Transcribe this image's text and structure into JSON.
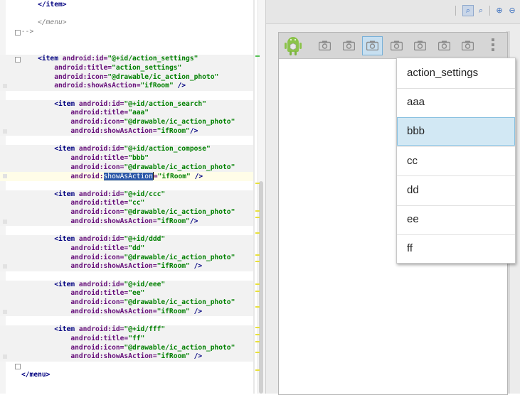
{
  "editor": {
    "lines": [
      [
        {
          "t": "    </item>",
          "c": "tag"
        }
      ],
      [],
      [
        {
          "t": "    </menu>",
          "c": "comment"
        }
      ],
      [
        {
          "t": "-->",
          "c": "comment"
        }
      ],
      [],
      [],
      [
        {
          "t": "    <item ",
          "c": "tag"
        },
        {
          "t": "android:id=",
          "c": "attr"
        },
        {
          "t": "\"@+id/action_settings\"",
          "c": "val"
        }
      ],
      [
        {
          "t": "        ",
          "c": "plain"
        },
        {
          "t": "android:title=",
          "c": "attr"
        },
        {
          "t": "\"action_settings\"",
          "c": "val"
        }
      ],
      [
        {
          "t": "        ",
          "c": "plain"
        },
        {
          "t": "android:icon=",
          "c": "attr"
        },
        {
          "t": "\"@drawable/ic_action_photo\"",
          "c": "val"
        }
      ],
      [
        {
          "t": "        ",
          "c": "plain"
        },
        {
          "t": "android:showAsAction=",
          "c": "attr"
        },
        {
          "t": "\"ifRoom\"",
          "c": "val"
        },
        {
          "t": " />",
          "c": "tag"
        }
      ],
      [],
      [
        {
          "t": "        <item ",
          "c": "tag"
        },
        {
          "t": "android:id=",
          "c": "attr"
        },
        {
          "t": "\"@+id/action_search\"",
          "c": "val"
        }
      ],
      [
        {
          "t": "            ",
          "c": "plain"
        },
        {
          "t": "android:title=",
          "c": "attr"
        },
        {
          "t": "\"aaa\"",
          "c": "val"
        }
      ],
      [
        {
          "t": "            ",
          "c": "plain"
        },
        {
          "t": "android:icon=",
          "c": "attr"
        },
        {
          "t": "\"@drawable/ic_action_photo\"",
          "c": "val"
        }
      ],
      [
        {
          "t": "            ",
          "c": "plain"
        },
        {
          "t": "android:showAsAction=",
          "c": "attr"
        },
        {
          "t": "\"ifRoom\"",
          "c": "val"
        },
        {
          "t": "/>",
          "c": "tag"
        }
      ],
      [],
      [
        {
          "t": "        <item ",
          "c": "tag"
        },
        {
          "t": "android:id=",
          "c": "attr"
        },
        {
          "t": "\"@+id/action_compose\"",
          "c": "val"
        }
      ],
      [
        {
          "t": "            ",
          "c": "plain"
        },
        {
          "t": "android:title=",
          "c": "attr"
        },
        {
          "t": "\"bbb\"",
          "c": "val"
        }
      ],
      [
        {
          "t": "            ",
          "c": "plain"
        },
        {
          "t": "android:icon=",
          "c": "attr"
        },
        {
          "t": "\"@drawable/ic_action_photo\"",
          "c": "val"
        }
      ],
      [
        {
          "t": "            ",
          "c": "plain"
        },
        {
          "t": "android:",
          "c": "attr"
        },
        {
          "t": "showAsAction",
          "c": "sel"
        },
        {
          "t": "",
          "c": "caret"
        },
        {
          "t": "=",
          "c": "attr"
        },
        {
          "t": "\"ifRoom\"",
          "c": "val"
        },
        {
          "t": " />",
          "c": "tag"
        }
      ],
      [],
      [
        {
          "t": "        <item ",
          "c": "tag"
        },
        {
          "t": "android:id=",
          "c": "attr"
        },
        {
          "t": "\"@+id/ccc\"",
          "c": "val"
        }
      ],
      [
        {
          "t": "            ",
          "c": "plain"
        },
        {
          "t": "android:title=",
          "c": "attr"
        },
        {
          "t": "\"cc\"",
          "c": "val"
        }
      ],
      [
        {
          "t": "            ",
          "c": "plain"
        },
        {
          "t": "android:icon=",
          "c": "attr"
        },
        {
          "t": "\"@drawable/ic_action_photo\"",
          "c": "val"
        }
      ],
      [
        {
          "t": "            ",
          "c": "plain"
        },
        {
          "t": "android:showAsAction=",
          "c": "attr"
        },
        {
          "t": "\"ifRoom\"",
          "c": "val"
        },
        {
          "t": "/>",
          "c": "tag"
        }
      ],
      [],
      [
        {
          "t": "        <item ",
          "c": "tag"
        },
        {
          "t": "android:id=",
          "c": "attr"
        },
        {
          "t": "\"@+id/ddd\"",
          "c": "val"
        }
      ],
      [
        {
          "t": "            ",
          "c": "plain"
        },
        {
          "t": "android:title=",
          "c": "attr"
        },
        {
          "t": "\"dd\"",
          "c": "val"
        }
      ],
      [
        {
          "t": "            ",
          "c": "plain"
        },
        {
          "t": "android:icon=",
          "c": "attr"
        },
        {
          "t": "\"@drawable/ic_action_photo\"",
          "c": "val"
        }
      ],
      [
        {
          "t": "            ",
          "c": "plain"
        },
        {
          "t": "android:showAsAction=",
          "c": "attr"
        },
        {
          "t": "\"ifRoom\"",
          "c": "val"
        },
        {
          "t": " />",
          "c": "tag"
        }
      ],
      [],
      [
        {
          "t": "        <item ",
          "c": "tag"
        },
        {
          "t": "android:id=",
          "c": "attr"
        },
        {
          "t": "\"@+id/eee\"",
          "c": "val"
        }
      ],
      [
        {
          "t": "            ",
          "c": "plain"
        },
        {
          "t": "android:title=",
          "c": "attr"
        },
        {
          "t": "\"ee\"",
          "c": "val"
        }
      ],
      [
        {
          "t": "            ",
          "c": "plain"
        },
        {
          "t": "android:icon=",
          "c": "attr"
        },
        {
          "t": "\"@drawable/ic_action_photo\"",
          "c": "val"
        }
      ],
      [
        {
          "t": "            ",
          "c": "plain"
        },
        {
          "t": "android:showAsAction=",
          "c": "attr"
        },
        {
          "t": "\"ifRoom\"",
          "c": "val"
        },
        {
          "t": " />",
          "c": "tag"
        }
      ],
      [],
      [
        {
          "t": "        <item ",
          "c": "tag"
        },
        {
          "t": "android:id=",
          "c": "attr"
        },
        {
          "t": "\"@+id/fff\"",
          "c": "val"
        }
      ],
      [
        {
          "t": "            ",
          "c": "plain"
        },
        {
          "t": "android:title=",
          "c": "attr"
        },
        {
          "t": "\"ff\"",
          "c": "val"
        }
      ],
      [
        {
          "t": "            ",
          "c": "plain"
        },
        {
          "t": "android:icon=",
          "c": "attr"
        },
        {
          "t": "\"@drawable/ic_action_photo\"",
          "c": "val"
        }
      ],
      [
        {
          "t": "            ",
          "c": "plain"
        },
        {
          "t": "android:showAsAction=",
          "c": "attr"
        },
        {
          "t": "\"ifRoom\"",
          "c": "val"
        },
        {
          "t": " />",
          "c": "tag"
        }
      ],
      [],
      [
        {
          "t": "</menu>",
          "c": "tag"
        }
      ]
    ],
    "grey_lines": [
      6,
      7,
      8,
      9,
      11,
      12,
      13,
      14,
      16,
      17,
      18,
      21,
      22,
      23,
      24,
      26,
      27,
      28,
      29,
      31,
      32,
      33,
      34,
      36,
      37,
      38,
      39
    ],
    "current_line": 19
  },
  "preview": {
    "zoom_buttons": [
      "zoom-to-fit",
      "zoom-actual",
      "zoom-in",
      "zoom-out"
    ],
    "action_bar": {
      "camera_count": 7,
      "selected_camera": 2
    },
    "overflow_menu": {
      "items": [
        "action_settings",
        "aaa",
        "bbb",
        "cc",
        "dd",
        "ee",
        "ff"
      ],
      "selected_index": 2
    }
  },
  "colors": {
    "tag": "#000080",
    "attribute": "#660e7a",
    "value": "#008000",
    "selection": "#2b57a8",
    "menu_selected": "#d2e8f4"
  }
}
